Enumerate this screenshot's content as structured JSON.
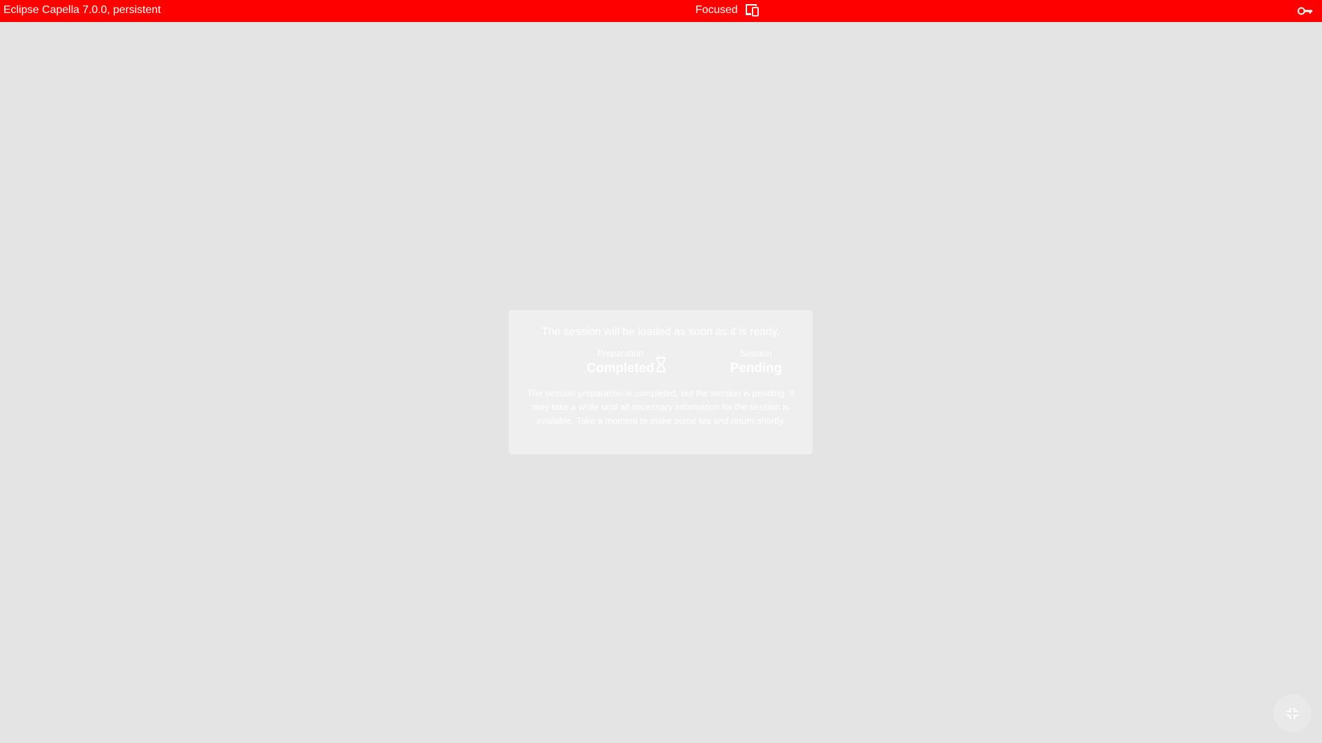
{
  "topbar": {
    "title": "Eclipse Capella 7.0.0, persistent",
    "mode_label": "Focused",
    "mode_icon": "devices-icon",
    "right_icon": "key-icon",
    "background_color": "#ff0000"
  },
  "status_card": {
    "headline": "The session will be loaded as soon as it is ready.",
    "preparation": {
      "label": "Preparation",
      "value": "Completed"
    },
    "wait_icon": "hourglass-icon",
    "session": {
      "label": "Session",
      "value": "Pending"
    },
    "description": "The session preparation is completed, but the session is pending. It may take a while until all necessary information for the session is available. Take a moment to make some tea and return shortly."
  },
  "fab": {
    "icon": "fullscreen-exit-icon"
  }
}
